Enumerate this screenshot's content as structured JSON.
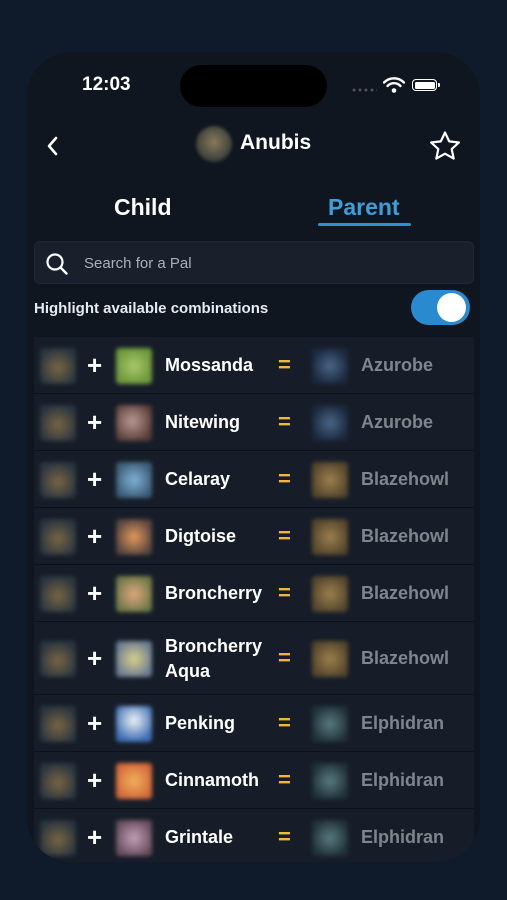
{
  "status": {
    "time": "12:03"
  },
  "header": {
    "title": "Anubis"
  },
  "tabs": [
    {
      "label": "Child"
    },
    {
      "label": "Parent"
    }
  ],
  "search": {
    "placeholder": "Search for a Pal"
  },
  "toggle": {
    "label": "Highlight available combinations",
    "on": true
  },
  "colors": {
    "accent": "#2a8ad0",
    "equals": "#f0b63e",
    "row_bg": "#161d28",
    "screen_bg": "#10161f"
  },
  "rows": [
    {
      "partner": "Mossanda",
      "result": "Azurobe"
    },
    {
      "partner": "Nitewing",
      "result": "Azurobe"
    },
    {
      "partner": "Celaray",
      "result": "Blazehowl"
    },
    {
      "partner": "Digtoise",
      "result": "Blazehowl"
    },
    {
      "partner": "Broncherry",
      "result": "Blazehowl"
    },
    {
      "partner": "Broncherry Aqua",
      "result": "Blazehowl"
    },
    {
      "partner": "Penking",
      "result": "Elphidran"
    },
    {
      "partner": "Cinnamoth",
      "result": "Elphidran"
    },
    {
      "partner": "Grintale",
      "result": "Elphidran"
    }
  ],
  "symbols": {
    "plus": "+",
    "equals": "="
  }
}
